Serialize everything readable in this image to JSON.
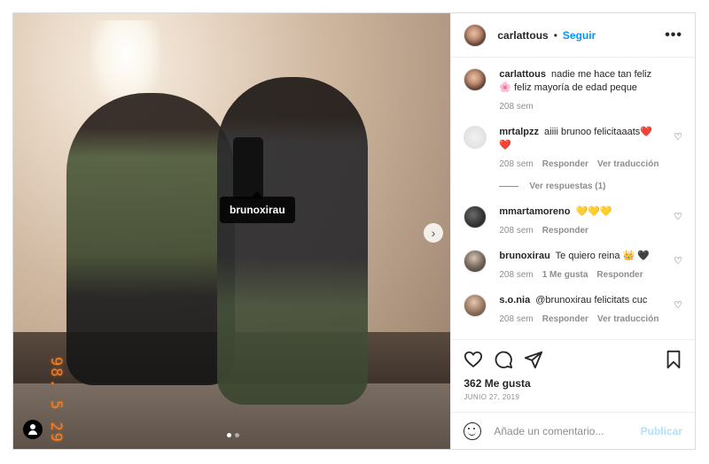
{
  "photo": {
    "tagged_user": "brunoxirau",
    "datestamp": "98. 5 29",
    "carousel": {
      "count": 2,
      "active": 0
    }
  },
  "header": {
    "username": "carlattous",
    "separator": "•",
    "follow_label": "Seguir",
    "more_icon": "more-horizontal-icon"
  },
  "caption": {
    "username": "carlattous",
    "text": "nadie me hace tan feliz🌸 feliz mayoría de edad peque",
    "time": "208 sem"
  },
  "comments": [
    {
      "username": "mrtalpzz",
      "text": "aiiii brunoo felicitaaats❤️❤️",
      "time": "208 sem",
      "reply_label": "Responder",
      "translate_label": "Ver traducción",
      "view_replies_label": "Ver respuestas (1)"
    },
    {
      "username": "mmartamoreno",
      "text": "💛💛💛",
      "time": "208 sem",
      "reply_label": "Responder"
    },
    {
      "username": "brunoxirau",
      "text": "Te quiero reina 👑 🖤",
      "time": "208 sem",
      "likes_label": "1 Me gusta",
      "reply_label": "Responder"
    },
    {
      "username": "s.o.nia",
      "text": "@brunoxirau felicitats cuc",
      "time": "208 sem",
      "reply_label": "Responder",
      "translate_label": "Ver traducción"
    }
  ],
  "actions": {
    "icons": [
      "heart-icon",
      "comment-icon",
      "share-icon",
      "bookmark-icon"
    ],
    "likes": "362 Me gusta",
    "date": "JUNIO 27, 2019"
  },
  "add_comment": {
    "placeholder": "Añade un comentario...",
    "publish_label": "Publicar"
  },
  "colors": {
    "accent": "#0095f6",
    "publish_disabled": "#b2dffc",
    "muted": "#8e8e8e",
    "datestamp": "#ff7a1a"
  }
}
